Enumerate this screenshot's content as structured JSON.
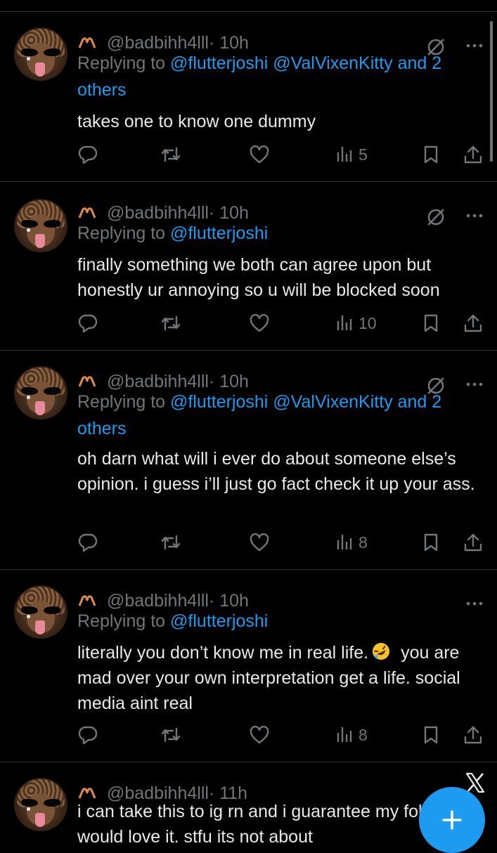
{
  "tweets": [
    {
      "handle": "@badbihh4lll",
      "time": "· 10h",
      "replying_prefix": "Replying to ",
      "mentions": "@flutterjoshi @ValVixenKitty and 2 others",
      "text": "takes one to know one dummy",
      "views": "5",
      "muted_icon": true
    },
    {
      "handle": "@badbihh4lll",
      "time": "· 10h",
      "replying_prefix": "Replying to ",
      "mentions": "@flutterjoshi",
      "text": "finally something we both can agree upon but honestly ur annoying so u will be blocked soon",
      "views": "10",
      "muted_icon": true
    },
    {
      "handle": "@badbihh4lll",
      "time": "· 10h",
      "replying_prefix": "Replying to ",
      "mentions": "@flutterjoshi @ValVixenKitty and 2 others",
      "text": "oh darn what will i ever do about someone else’s opinion. i guess i’ll just go fact check it up your ass.",
      "views": "8",
      "muted_icon": true
    },
    {
      "handle": "@badbihh4lll",
      "time": "· 10h",
      "replying_prefix": "Replying to ",
      "mentions": "@flutterjoshi",
      "text_before_emoji": "literally you don’t know me in real life.",
      "text_after_emoji": "you are mad over your own interpretation get a life. social media aint real",
      "views": "8",
      "muted_icon": false
    },
    {
      "handle": "@badbihh4lll",
      "time": "· 11h",
      "text": "i can take this to ig rn and i guarantee my followers would love it. stfu its not about"
    }
  ],
  "icons": {
    "reply": "reply-icon",
    "retweet": "retweet-icon",
    "like": "heart-icon",
    "views": "views-icon",
    "bookmark": "bookmark-icon",
    "share": "share-icon",
    "compose": "plus-icon"
  },
  "colors": {
    "background": "#000000",
    "text": "#e7e9ea",
    "secondary": "#71767b",
    "accent": "#1d9bf0"
  }
}
